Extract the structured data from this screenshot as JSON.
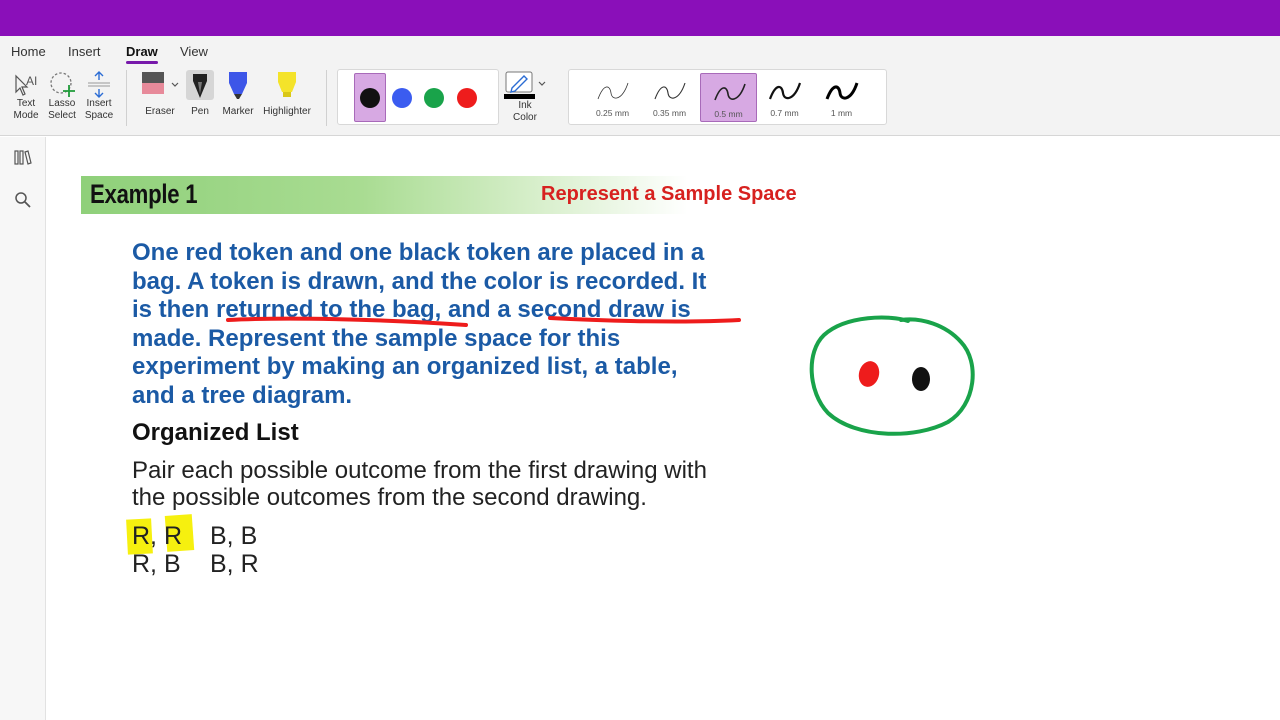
{
  "ribbon": {
    "tabs": [
      "Home",
      "Insert",
      "Draw",
      "View"
    ],
    "active_tab": "Draw",
    "tools": {
      "text_mode": [
        "Text",
        "Mode"
      ],
      "lasso_select": [
        "Lasso",
        "Select"
      ],
      "insert_space": [
        "Insert",
        "Space"
      ],
      "eraser": "Eraser",
      "pen": "Pen",
      "marker": "Marker",
      "highlighter": "Highlighter"
    },
    "pen_colors": [
      "#111111",
      "#3b5cf0",
      "#19a34a",
      "#ee1c1c"
    ],
    "ink_color": [
      "Ink",
      "Color"
    ],
    "thickness": [
      "0.25 mm",
      "0.35 mm",
      "0.5 mm",
      "0.7 mm",
      "1 mm"
    ],
    "selected_thickness": "0.5 mm",
    "accent_color": "#8a0fb9"
  },
  "sidebar": {
    "icons": [
      "notebooks-icon",
      "search-icon"
    ]
  },
  "page": {
    "banner": {
      "example": "Example 1",
      "title": "Represent a Sample Space"
    },
    "problem_lines": [
      "One red token and one black token are placed in a",
      "bag. A token is drawn, and the color is recorded. It",
      "is then returned to the bag, and a second draw is",
      "made. Represent the sample space for this",
      "experiment by making an organized list, a table,",
      "and a tree diagram."
    ],
    "heading": "Organized List",
    "pair_lines": [
      "Pair each possible outcome from the first drawing with",
      "the possible outcomes from the second drawing."
    ],
    "outcomes": [
      [
        "R, R",
        "B, B"
      ],
      [
        "R, B",
        "B, R"
      ]
    ]
  }
}
